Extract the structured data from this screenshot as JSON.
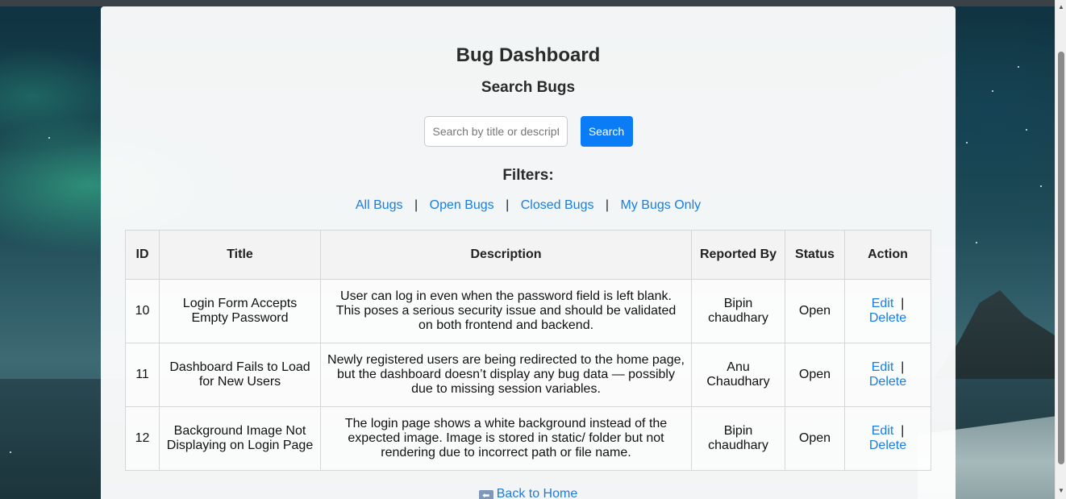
{
  "page": {
    "title": "Bug Dashboard",
    "search_heading": "Search Bugs",
    "filters_heading": "Filters:"
  },
  "search": {
    "placeholder": "Search by title or description",
    "value": "",
    "button_label": "Search"
  },
  "filters": [
    {
      "label": "All Bugs"
    },
    {
      "label": "Open Bugs"
    },
    {
      "label": "Closed Bugs"
    },
    {
      "label": "My Bugs Only"
    }
  ],
  "filter_separator": "|",
  "table": {
    "headers": [
      "ID",
      "Title",
      "Description",
      "Reported By",
      "Status",
      "Action"
    ],
    "rows": [
      {
        "id": "10",
        "title": "Login Form Accepts Empty Password",
        "description": "User can log in even when the password field is left blank. This poses a serious security issue and should be validated on both frontend and backend.",
        "reported_by": "Bipin chaudhary",
        "status": "Open",
        "edit_label": "Edit",
        "delete_label": "Delete"
      },
      {
        "id": "11",
        "title": "Dashboard Fails to Load for New Users",
        "description": "Newly registered users are being redirected to the home page, but the dashboard doesn’t display any bug data — possibly due to missing session variables.",
        "reported_by": "Anu Chaudhary",
        "status": "Open",
        "edit_label": "Edit",
        "delete_label": "Delete"
      },
      {
        "id": "12",
        "title": "Background Image Not Displaying on Login Page",
        "description": "The login page shows a white background instead of the expected image. Image is stored in static/ folder but not rendering due to incorrect path or file name.",
        "reported_by": "Bipin chaudhary",
        "status": "Open",
        "edit_label": "Edit",
        "delete_label": "Delete"
      }
    ],
    "action_separator": "|"
  },
  "back_link": {
    "icon": "back-arrow-icon",
    "label": "Back to Home"
  },
  "colors": {
    "accent": "#0a7cf5",
    "link": "#1a7ee0",
    "card_bg": "#f7f9fa"
  }
}
